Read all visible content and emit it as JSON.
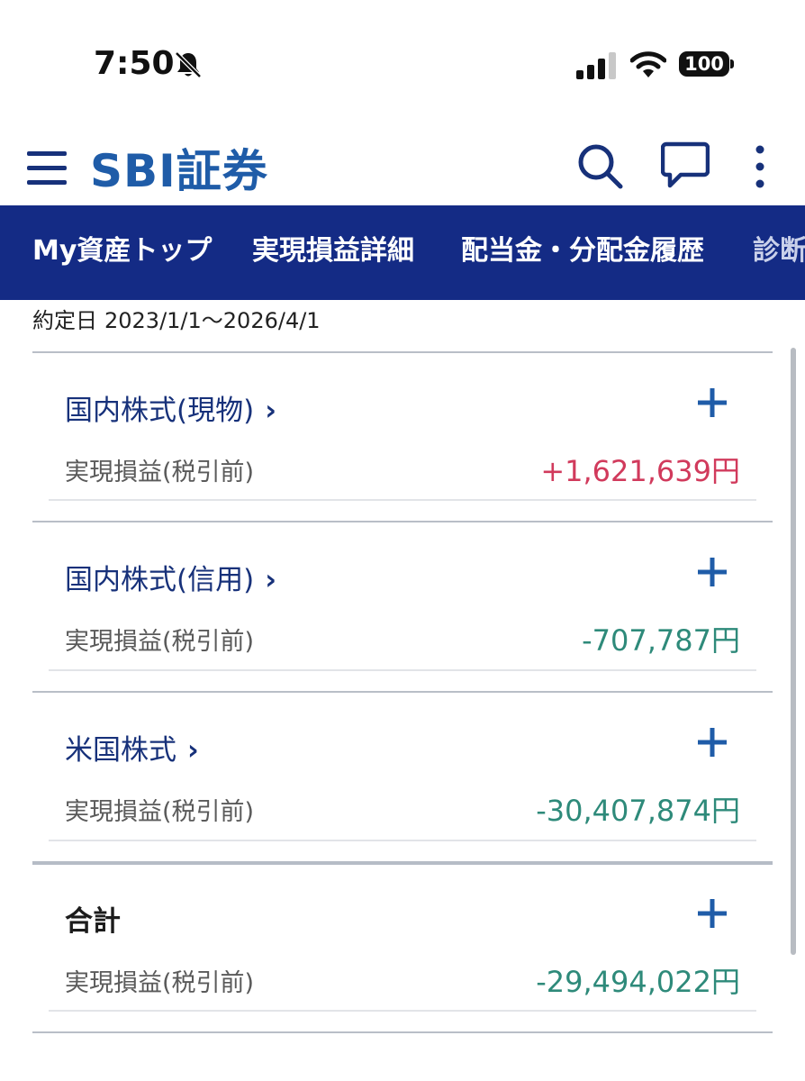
{
  "status_bar": {
    "time": "7:50",
    "battery": "100"
  },
  "header": {
    "brand": "SBI証券"
  },
  "tabs": [
    {
      "label": "My資産トップ"
    },
    {
      "label": "実現損益詳細"
    },
    {
      "label": "配当金・分配金履歴"
    },
    {
      "label": "診断"
    }
  ],
  "date_range": {
    "label": "約定日",
    "value": "2023/1/1〜2026/4/1"
  },
  "sections": [
    {
      "title": "国内株式(現物)",
      "chevron": "›",
      "pl_label": "実現損益(税引前)",
      "pl_value": "+1,621,639円",
      "sign": "positive"
    },
    {
      "title": "国内株式(信用)",
      "chevron": "›",
      "pl_label": "実現損益(税引前)",
      "pl_value": "-707,787円",
      "sign": "negative"
    },
    {
      "title": "米国株式",
      "chevron": "›",
      "pl_label": "実現損益(税引前)",
      "pl_value": "-30,407,874円",
      "sign": "negative"
    },
    {
      "title": "合計",
      "pl_label": "実現損益(税引前)",
      "pl_value": "-29,494,022円",
      "sign": "negative"
    }
  ],
  "colors": {
    "brand": "#1f5ca8",
    "tab_bar": "#142b85",
    "positive": "#d13a5c",
    "negative": "#2e8a7a",
    "link": "#17317a"
  },
  "icons": [
    "bell-slash-icon",
    "signal-icon",
    "wifi-icon",
    "battery-icon",
    "menu-icon",
    "search-icon",
    "chat-icon",
    "more-vertical-icon",
    "plus-icon",
    "chevron-right-icon"
  ]
}
